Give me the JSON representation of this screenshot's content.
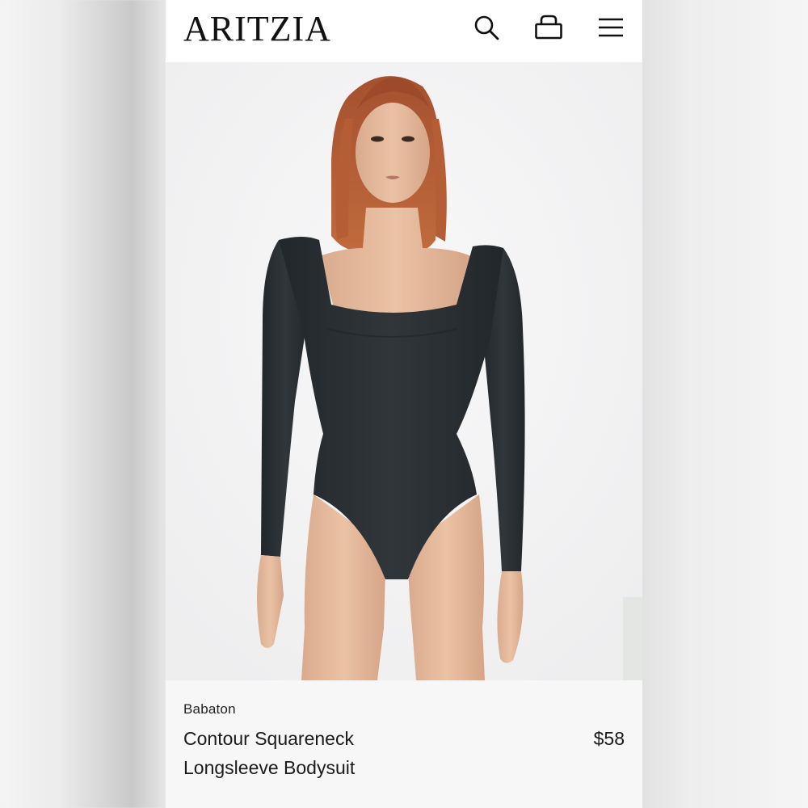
{
  "header": {
    "logo_text": "ARITZIA",
    "icons": [
      "search-icon",
      "shopping-bag-icon",
      "hamburger-menu-icon"
    ]
  },
  "product": {
    "brand": "Babaton",
    "name": "Contour Squareneck Longsleeve Bodysuit",
    "price": "$58",
    "image_alt": "Model wearing black long sleeve square neck bodysuit"
  },
  "colors": {
    "background": "#ececec",
    "page": "#ffffff",
    "image_bg": "#f4f4f5",
    "info_bg": "#f7f7f7",
    "garment": "#2a2e2f",
    "text": "#1a1a1a"
  }
}
